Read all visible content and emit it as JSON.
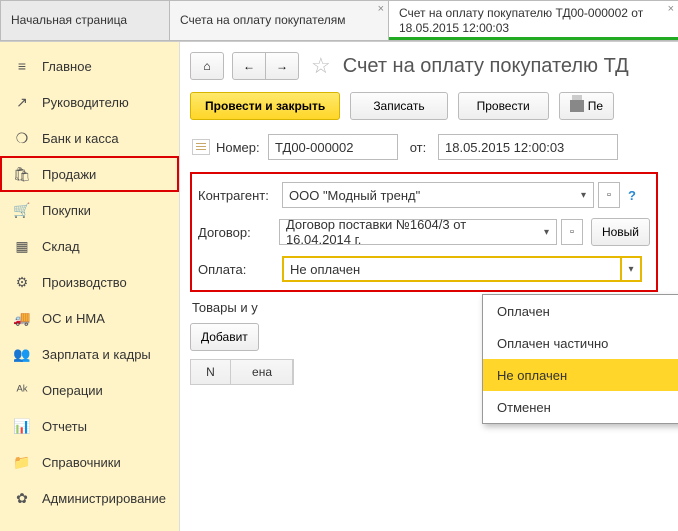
{
  "tabs": {
    "home": "Начальная страница",
    "list": "Счета на оплату покупателям",
    "doc": "Счет на оплату покупателю ТД00-000002 от 18.05.2015 12:00:03"
  },
  "sidebar": {
    "items": [
      {
        "label": "Главное",
        "icon": "≡"
      },
      {
        "label": "Руководителю",
        "icon": "↗"
      },
      {
        "label": "Банк и касса",
        "icon": "❍"
      },
      {
        "label": "Продажи",
        "icon": "🛍",
        "highlight": true
      },
      {
        "label": "Покупки",
        "icon": "🛒"
      },
      {
        "label": "Склад",
        "icon": "▦"
      },
      {
        "label": "Производство",
        "icon": "⚙"
      },
      {
        "label": "ОС и НМА",
        "icon": "🚚"
      },
      {
        "label": "Зарплата и кадры",
        "icon": "👥"
      },
      {
        "label": "Операции",
        "icon": "ᴬᵏ"
      },
      {
        "label": "Отчеты",
        "icon": "📊"
      },
      {
        "label": "Справочники",
        "icon": "📁"
      },
      {
        "label": "Администрирование",
        "icon": "✿"
      }
    ]
  },
  "header": {
    "title": "Счет на оплату покупателю ТД"
  },
  "toolbar": {
    "post_close": "Провести и закрыть",
    "save": "Записать",
    "post": "Провести",
    "print": "Пе"
  },
  "form": {
    "number_label": "Номер:",
    "number_value": "ТД00-000002",
    "date_label": "от:",
    "date_value": "18.05.2015 12:00:03",
    "partner_label": "Контрагент:",
    "partner_value": "ООО \"Модный тренд\"",
    "contract_label": "Договор:",
    "contract_value": "Договор поставки №1604/3 от 16.04.2014 г.",
    "new_btn": "Новый",
    "payment_label": "Оплата:",
    "payment_value": "Не оплачен"
  },
  "dropdown": {
    "options": [
      "Оплачен",
      "Оплачен частично",
      "Не оплачен",
      "Отменен"
    ],
    "selected_index": 2
  },
  "goods": {
    "section": "Товары и у",
    "add_btn": "Добавит",
    "col_n": "N",
    "col_price": "ена"
  }
}
